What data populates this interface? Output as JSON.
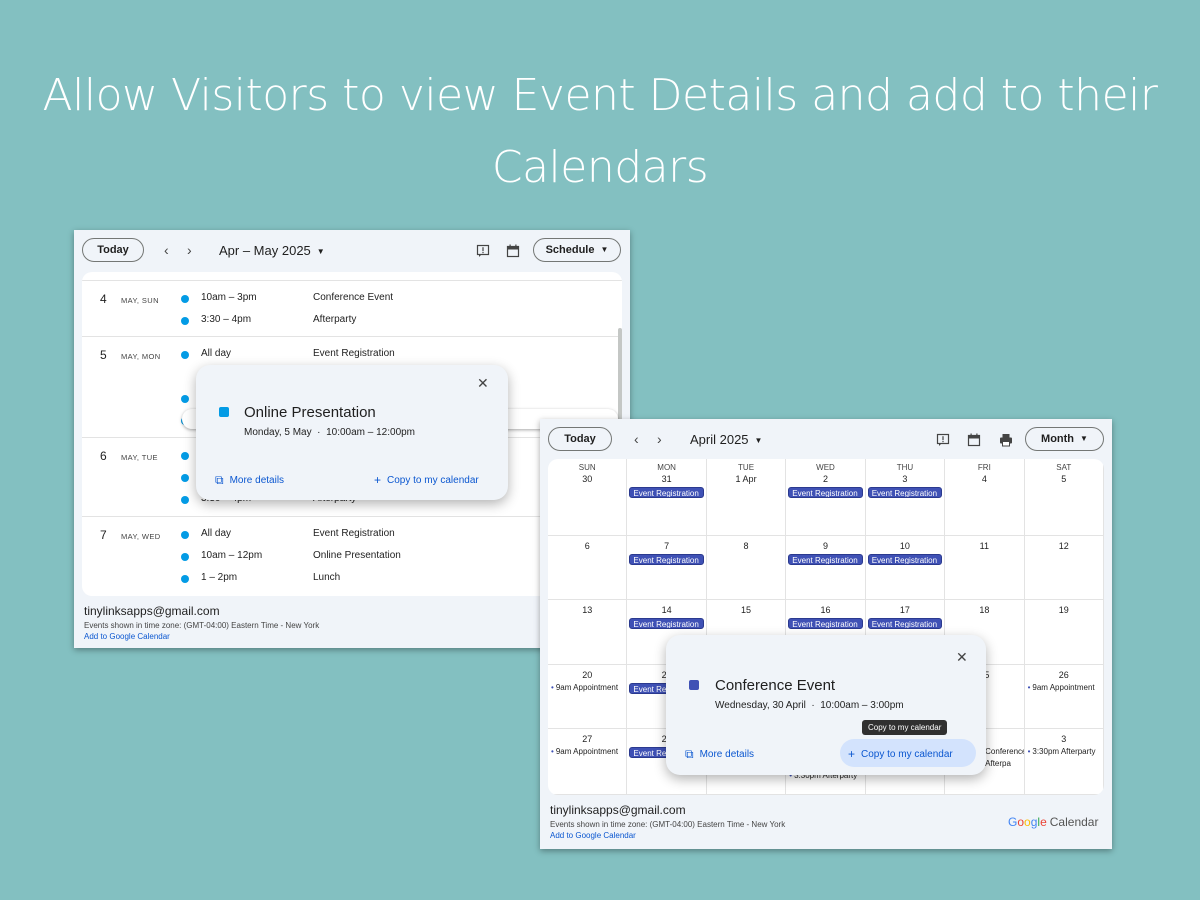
{
  "headline": "Allow Visitors to view Event Details and add to their Calendars",
  "schedule_view": {
    "today_label": "Today",
    "prev_icon": "chevron-left-icon",
    "next_icon": "chevron-right-icon",
    "range": "Apr – May 2025",
    "view_label": "Schedule",
    "days": [
      {
        "num": "4",
        "sub": "MAY, SUN",
        "events": [
          {
            "time": "10am – 3pm",
            "title": "Conference Event"
          },
          {
            "time": "3:30 – 4pm",
            "title": "Afterparty"
          }
        ]
      },
      {
        "num": "5",
        "sub": "MAY, MON",
        "events": [
          {
            "time": "All day",
            "title": "Event Registration"
          },
          {
            "time": "",
            "title": ""
          },
          {
            "time": "",
            "title": ""
          },
          {
            "time": "",
            "title": ""
          }
        ]
      },
      {
        "num": "6",
        "sub": "MAY, TUE",
        "events": [
          {
            "time": "",
            "title": ""
          },
          {
            "time": "",
            "title": ""
          },
          {
            "time": "3:30 – 4pm",
            "title": "Afterparty"
          }
        ]
      },
      {
        "num": "7",
        "sub": "MAY, WED",
        "events": [
          {
            "time": "All day",
            "title": "Event Registration"
          },
          {
            "time": "10am – 12pm",
            "title": "Online Presentation"
          },
          {
            "time": "1 – 2pm",
            "title": "Lunch"
          }
        ]
      }
    ],
    "popup": {
      "title": "Online Presentation",
      "when": "Monday, 5 May  ·  10:00am – 12:00pm",
      "more_details": "More details",
      "copy": "Copy to my calendar",
      "color": "#039be5"
    },
    "footer": {
      "account": "tinylinksapps@gmail.com",
      "timezone": "Events shown in time zone: (GMT-04:00) Eastern Time - New York",
      "add_link": "Add to Google Calendar"
    }
  },
  "month_view": {
    "today_label": "Today",
    "range": "April 2025",
    "view_label": "Month",
    "weekdays": [
      "SUN",
      "MON",
      "TUE",
      "WED",
      "THU",
      "FRI",
      "SAT"
    ],
    "weeks": [
      [
        {
          "d": "30"
        },
        {
          "d": "31",
          "chip": "Event Registration"
        },
        {
          "d": "1 Apr"
        },
        {
          "d": "2",
          "chip": "Event Registration"
        },
        {
          "d": "3",
          "chip": "Event Registration"
        },
        {
          "d": "4"
        },
        {
          "d": "5"
        }
      ],
      [
        {
          "d": "6"
        },
        {
          "d": "7",
          "chip": "Event Registration"
        },
        {
          "d": "8"
        },
        {
          "d": "9",
          "chip": "Event Registration"
        },
        {
          "d": "10",
          "chip": "Event Registration"
        },
        {
          "d": "11"
        },
        {
          "d": "12"
        }
      ],
      [
        {
          "d": "13"
        },
        {
          "d": "14",
          "chip": "Event Registration"
        },
        {
          "d": "15"
        },
        {
          "d": "16",
          "chip": "Event Registration"
        },
        {
          "d": "17",
          "chip": "Event Registration"
        },
        {
          "d": "18"
        },
        {
          "d": "19"
        }
      ],
      [
        {
          "d": "20",
          "dot": "9am Appointment"
        },
        {
          "d": "21",
          "chip": "Event Registration"
        },
        {
          "d": ""
        },
        {
          "d": ""
        },
        {
          "d": ""
        },
        {
          "d": "25"
        },
        {
          "d": "26",
          "dot": "9am Appointment"
        }
      ],
      [
        {
          "d": "27",
          "dot": "9am Appointment"
        },
        {
          "d": "28",
          "chip": "Event Registration"
        },
        {
          "d": ""
        },
        {
          "d": "",
          "dot": "3:30pm Afterparty"
        },
        {
          "d": ""
        },
        {
          "d": "",
          "extra": [
            "Conference",
            "Afterpa"
          ]
        },
        {
          "d": "3",
          "dot": "3:30pm Afterparty"
        }
      ]
    ],
    "popup": {
      "title": "Conference Event",
      "when": "Wednesday, 30 April  ·  10:00am – 3:00pm",
      "more_details": "More details",
      "copy": "Copy to my calendar",
      "tooltip": "Copy to my calendar",
      "color": "#3f51b5"
    },
    "footer": {
      "account": "tinylinksapps@gmail.com",
      "timezone": "Events shown in time zone: (GMT-04:00) Eastern Time - New York",
      "add_link": "Add to Google Calendar"
    },
    "logo": {
      "google": "Google",
      "calendar": "Calendar"
    }
  }
}
